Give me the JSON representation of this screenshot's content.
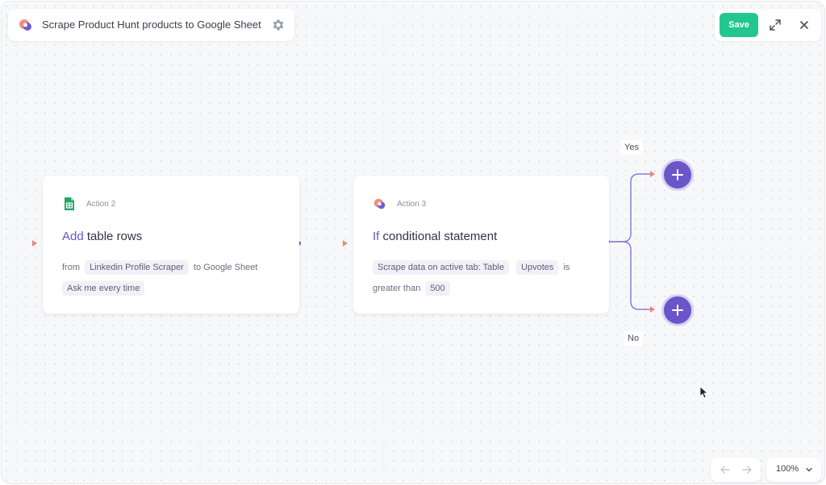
{
  "header": {
    "title": "Scrape Product Hunt products to Google Sheet",
    "save_label": "Save"
  },
  "cards": {
    "action2": {
      "label": "Action 2",
      "title_keyword": "Add",
      "title_rest": " table rows",
      "line1_prefix": "from",
      "line1_chip": "Linkedin Profile Scraper",
      "line1_suffix": "to Google Sheet",
      "line2_chip": "Ask me every time"
    },
    "action3": {
      "label": "Action 3",
      "title_keyword": "If",
      "title_rest": " conditional statement",
      "line1_chip1": "Scrape data on active tab: Table",
      "line1_chip2": "Upvotes",
      "line1_suffix": "is",
      "line2_prefix": "greater than",
      "line2_chip": "500"
    }
  },
  "branches": {
    "yes_label": "Yes",
    "no_label": "No"
  },
  "footer": {
    "zoom": "100%"
  },
  "colors": {
    "accent": "#6a56c9",
    "save": "#22c78f",
    "connector": "#e8887e"
  }
}
